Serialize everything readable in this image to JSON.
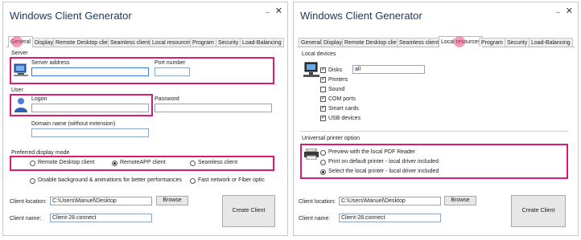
{
  "app_title": "Windows Client Generator",
  "window_controls": {
    "minimize_glyph": "_",
    "close_glyph": "✕"
  },
  "tabs": [
    "General",
    "Display",
    "Remote Desktop client",
    "Seamless client",
    "Local resources",
    "Program",
    "Security",
    "Load-Balancing"
  ],
  "left": {
    "active_tab": "General",
    "server": {
      "section": "Server",
      "address_label": "Server address",
      "address_value": "",
      "port_label": "Port number",
      "port_value": ""
    },
    "user": {
      "section": "User",
      "logon_label": "Logon",
      "logon_value": "",
      "password_label": "Password",
      "password_value": "",
      "domain_label": "Domain name (without extension)",
      "domain_value": ""
    },
    "display_mode": {
      "section": "Preferred display mode",
      "options": [
        "Remote Desktop client",
        "RemoteAPP client",
        "Seamless client"
      ],
      "selected": "RemoteAPP client",
      "disable_bg": "Disable background & animations for better performances",
      "fast_network": "Fast network or Fiber optic"
    }
  },
  "right": {
    "active_tab": "Local resources",
    "local_devices": {
      "section": "Local devices",
      "items": [
        {
          "label": "Disks",
          "checked": true
        },
        {
          "label": "Printers",
          "checked": true
        },
        {
          "label": "Sound",
          "checked": false
        },
        {
          "label": "COM ports",
          "checked": true
        },
        {
          "label": "Smart cards",
          "checked": true
        },
        {
          "label": "USB devices",
          "checked": true
        }
      ],
      "disks_value": "all"
    },
    "printer": {
      "section": "Universal printer option",
      "options": [
        "Preview with the local PDF Reader",
        "Print on default printer - local driver included",
        "Select the local printer - local driver included"
      ],
      "selected": "Select the local printer - local driver included"
    }
  },
  "footer": {
    "client_location_label": "Client location:",
    "client_location_value": "C:\\Users\\Manuel\\Desktop",
    "client_name_label": "Client name:",
    "client_name_value": "Client-28.connect",
    "browse_label": "Browse",
    "create_label": "Create Client"
  },
  "colors": {
    "highlight": "#d81b74",
    "marker": "#e74878",
    "title": "#1b3a63"
  },
  "icons": [
    "computer-icon",
    "user-icon",
    "monitor-speaker-icon",
    "printer-icon"
  ]
}
